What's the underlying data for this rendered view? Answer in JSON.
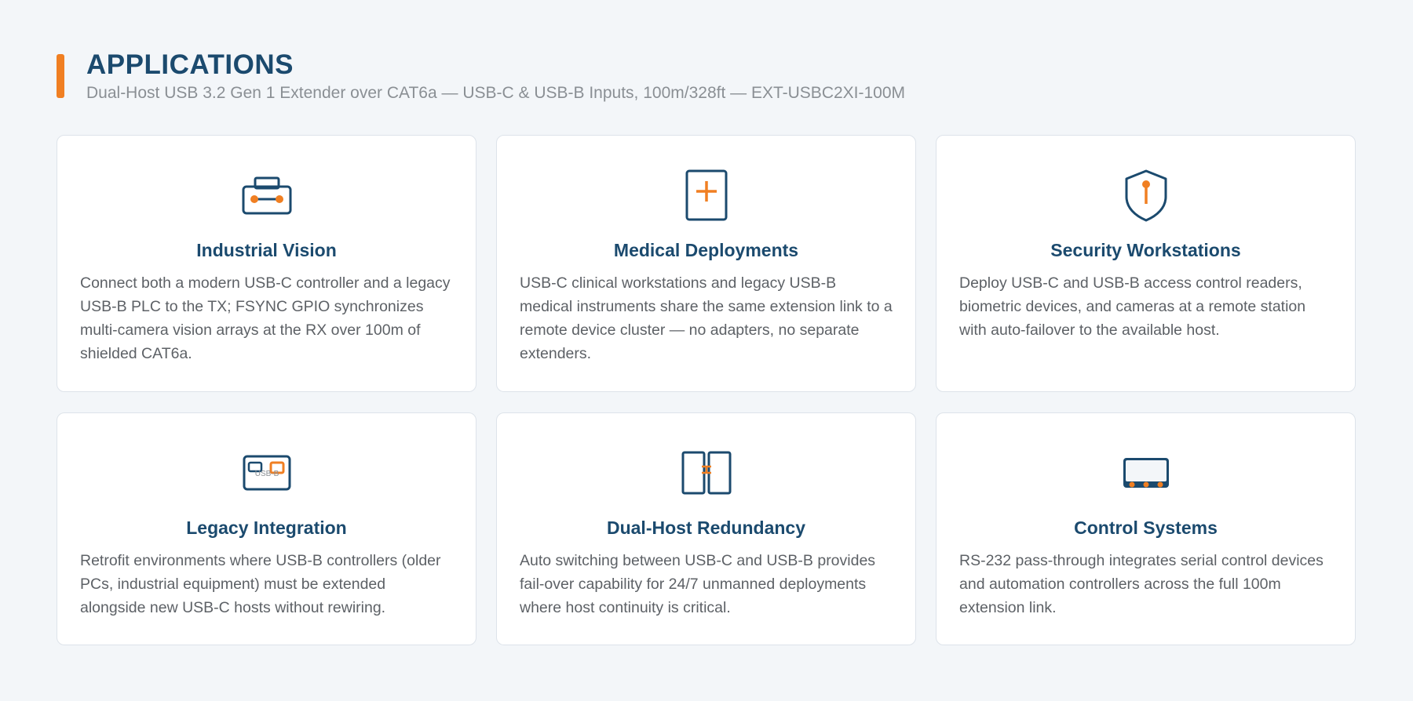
{
  "header": {
    "title": "APPLICATIONS",
    "subtitle": "Dual-Host USB 3.2 Gen 1 Extender over CAT6a — USB-C & USB-B Inputs, 100m/328ft — EXT-USBC2XI-100M"
  },
  "colors": {
    "accent": "#f07f22",
    "primary": "#1b4a6e",
    "text": "#5d6166",
    "background": "#f3f6f9"
  },
  "cards": [
    {
      "icon": "toolbox-icon",
      "title": "Industrial Vision",
      "description": "Connect both a modern USB-C controller and a legacy USB-B PLC to the TX; FSYNC GPIO synchronizes multi-camera vision arrays at the RX over 100m of shielded CAT6a."
    },
    {
      "icon": "medical-cross-icon",
      "title": "Medical Deployments",
      "description": "USB-C clinical workstations and legacy USB-B medical instruments share the same extension link to a remote device cluster — no adapters, no separate extenders."
    },
    {
      "icon": "shield-icon",
      "title": "Security Workstations",
      "description": "Deploy USB-C and USB-B access control readers, biometric devices, and cameras at a remote station with auto-failover to the available host."
    },
    {
      "icon": "legacy-port-icon",
      "icon_label": "USB-B",
      "title": "Legacy Integration",
      "description": "Retrofit environments where USB-B controllers (older PCs, industrial equipment) must be extended alongside new USB-C hosts without rewiring."
    },
    {
      "icon": "dual-host-icon",
      "title": "Dual-Host Redundancy",
      "description": "Auto switching between USB-C and USB-B provides fail-over capability for 24/7 unmanned deployments where host continuity is critical."
    },
    {
      "icon": "control-panel-icon",
      "title": "Control Systems",
      "description": "RS-232 pass-through integrates serial control devices and automation controllers across the full 100m extension link."
    }
  ]
}
